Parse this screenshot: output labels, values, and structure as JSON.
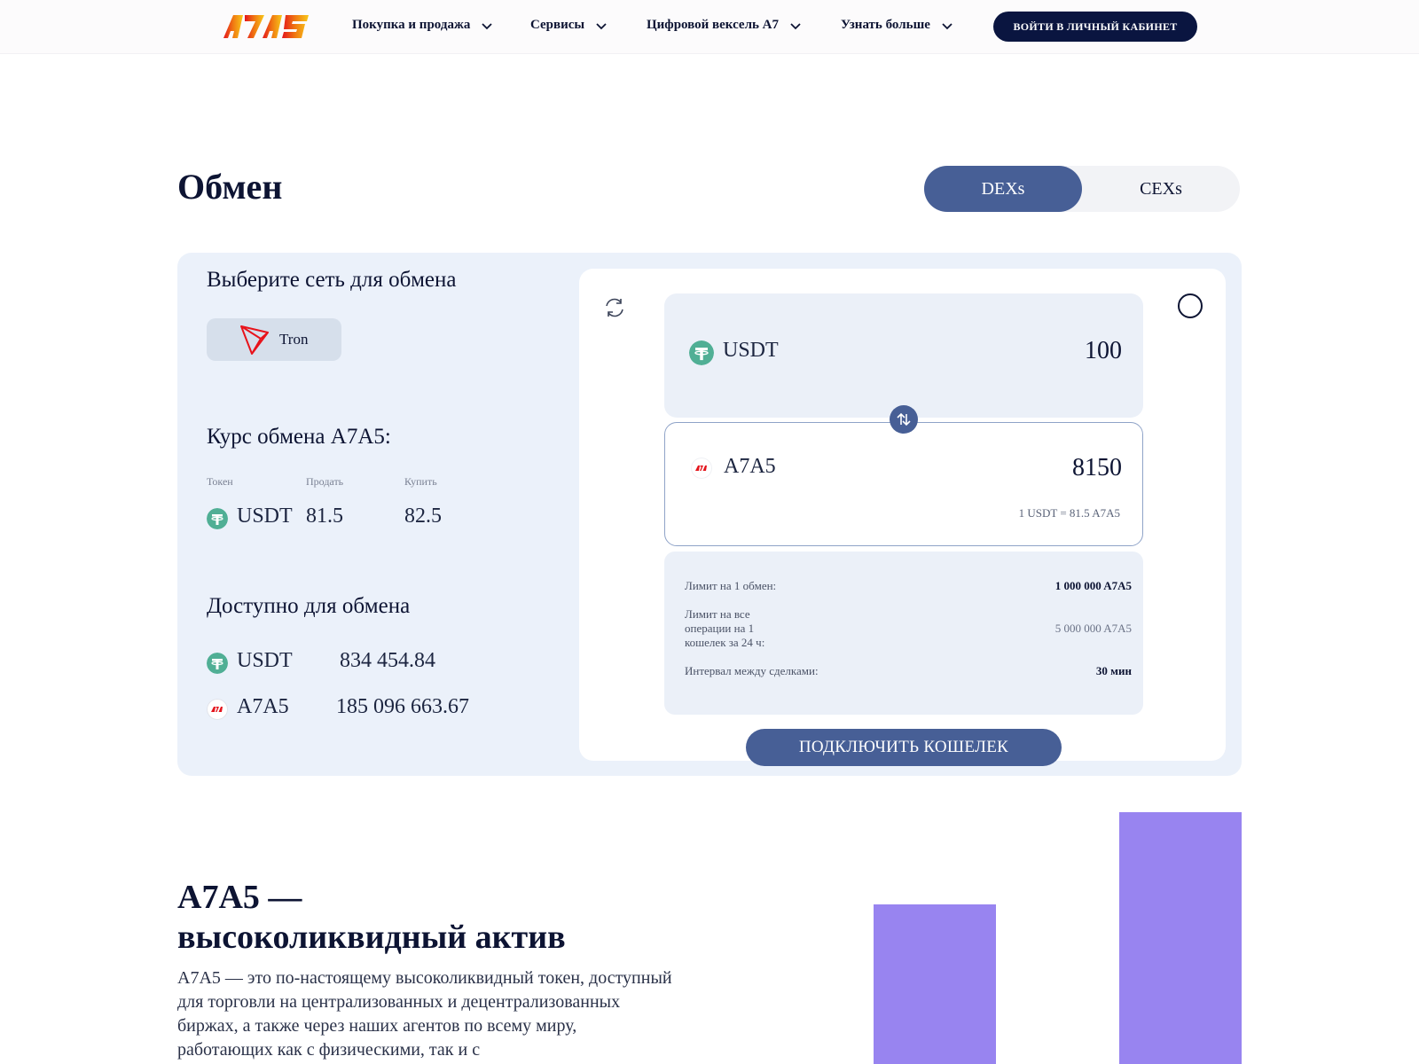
{
  "header": {
    "logo_text": "A7A5",
    "nav": [
      {
        "label": "Покупка и продажа"
      },
      {
        "label": "Сервисы"
      },
      {
        "label": "Цифровой вексель А7"
      },
      {
        "label": "Узнать больше"
      }
    ],
    "login_label": "ВОЙТИ В ЛИЧНЫЙ КАБИНЕТ"
  },
  "page": {
    "title": "Обмен",
    "toggle": {
      "active": "DEXs",
      "inactive": "CEXs"
    }
  },
  "left": {
    "network_title": "Выберите сеть для обмена",
    "network_chip": "Tron",
    "rate_title": "Курс обмена A7A5:",
    "rate_headers": [
      "Токен",
      "Продать",
      "Купить"
    ],
    "rate_row": {
      "token": "USDT",
      "sell": "81.5",
      "buy": "82.5"
    },
    "available_title": "Доступно для обмена",
    "available": [
      {
        "token": "USDT",
        "amount": "834 454.84"
      },
      {
        "token": "A7A5",
        "amount": "185 096 663.67"
      }
    ]
  },
  "exchange": {
    "from": {
      "token": "USDT",
      "amount": "100"
    },
    "to": {
      "token": "A7A5",
      "amount": "8150"
    },
    "rate_line": "1 USDT = 81.5 A7A5",
    "limits": [
      {
        "label": "Лимит на 1 обмен:",
        "value": "1 000 000 A7A5"
      },
      {
        "label": "Лимит на все операции на 1 кошелек за 24 ч:",
        "value": "5 000 000 A7A5"
      },
      {
        "label": "Интервал между сделками:",
        "value": "30 мин"
      }
    ],
    "connect_label": "ПОДКЛЮЧИТЬ КОШЕЛЕК"
  },
  "about": {
    "title_line1": "A7A5 —",
    "title_line2": "высоколиквидный актив",
    "paragraph": "A7A5 — это по-настоящему высоколиквидный токен, доступный для торговли на централизованных и децентрализованных биржах, а также через наших агентов по всему миру, работающих как с физическими, так и с"
  },
  "colors": {
    "primary": "#475f96",
    "dark": "#0a1540",
    "panel": "#ebf1fa",
    "tether": "#50af95",
    "bars": "#9884f0",
    "tron": "#e8131b"
  },
  "icons": [
    "logo",
    "chevron-down-icon",
    "tron-icon",
    "tether-icon",
    "a7a5-icon",
    "refresh-icon",
    "settings-circle-icon",
    "swap-icon"
  ]
}
